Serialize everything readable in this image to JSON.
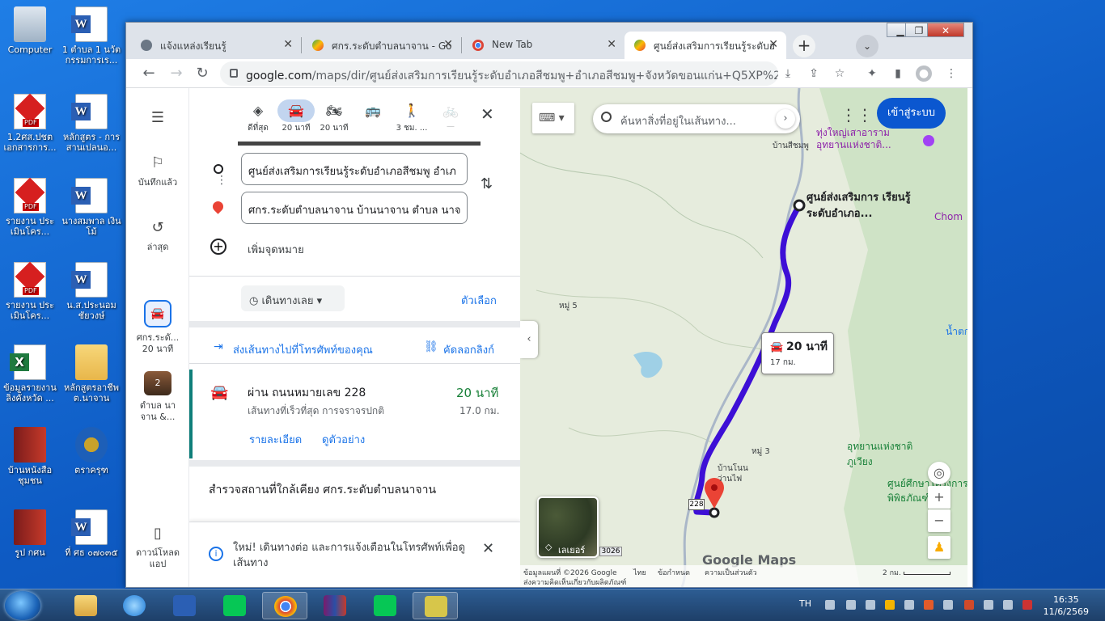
{
  "desktop": {
    "icons_col1": [
      "Computer",
      "1.2ศส.ปชต เอกสารการ...",
      "รายงาน ประเมินโคร...",
      "รายงาน ประเมินโคร...",
      "ข้อมูลรายงาน ลิ่งคั่งหวัด ...",
      "บ้านหนังสือ ชุมชน",
      "รูป กศน"
    ],
    "icons_col2": [
      "1 ตำบล 1 นวัต กรรมการเร...",
      "หลักสูตร - การ สานเปลนอ...",
      "นางสมพาล เงินโม้",
      "น.ส.ประนอม ชัยวงษ์",
      "หลักสูตรอาชีพ ต.นาจาน",
      "ตราครุฑ",
      "ที่ ศธ ๐๗๐๓๕"
    ]
  },
  "browser": {
    "tabs": [
      {
        "title": "แจ้งแหล่งเรียนรู้",
        "close": "✕"
      },
      {
        "title": "ศกร.ระดับตำบลนาจาน - Go",
        "close": "✕"
      },
      {
        "title": "New Tab",
        "close": "✕"
      },
      {
        "title": "ศูนย์ส่งเสริมการเรียนรู้ระดับอ",
        "close": "✕"
      }
    ],
    "new_tab": "+",
    "tab_menu": "⌄",
    "url_host": "google.com",
    "url_path": "/maps/dir/ศูนย์ส่งเสริมการเรียนรู้ระดับอำเภอสีชมพู+อำเภอสีชมพู+จังหวัดขอนแก่น+Q5XP%2B9PR..."
  },
  "rail": {
    "saved": "บันทึกแล้ว",
    "recent": "ล่าสุด",
    "route1_line1": "ศกร.ระดั...",
    "route1_line2": "20 นาที",
    "route2_line1": "ตำบล นา",
    "route2_line2": "จาน &...",
    "route2_badge": "2",
    "download_line1": "ดาวน์โหลด",
    "download_line2": "แอป"
  },
  "directions": {
    "modes": [
      {
        "label": "ดีที่สุด",
        "icon": "◈"
      },
      {
        "label": "20 นาที",
        "icon": "🚘"
      },
      {
        "label": "20 นาที",
        "icon": "🏍"
      },
      {
        "label": "",
        "icon": "🚌"
      },
      {
        "label": "3 ชม. ...",
        "icon": "🚶"
      },
      {
        "label": "—",
        "icon": "🚲"
      }
    ],
    "close": "✕",
    "origin": "ศูนย์ส่งเสริมการเรียนรู้ระดับอำเภอสีชมพู อำเภ",
    "destination": "ศกร.ระดับตำบลนาจาน บ้านนาจาน ตำบล นาจ",
    "add_destination": "เพิ่มจุดหมาย",
    "depart": "เดินทางเลย",
    "options": "ตัวเลือก",
    "send_to_phone": "ส่งเส้นทางไปที่โทรศัพท์ของคุณ",
    "copy_link": "คัดลอกลิงก์",
    "route": {
      "via": "ผ่าน ถนนหมายเลข 228",
      "time": "20 นาที",
      "desc": "เส้นทางที่เร็วที่สุด การจราจรปกติ",
      "distance": "17.0 กม.",
      "details": "รายละเอียด",
      "preview": "ดูตัวอย่าง"
    },
    "explore": "สำรวจสถานที่ใกล้เคียง ศกร.ระดับตำบลนาจาน",
    "notice": "ใหม่! เดินทางต่อ และการแจ้งเตือนในโทรศัพท์เพื่อดูเส้นทาง",
    "notice_close": "✕"
  },
  "map": {
    "search_placeholder": "ค้นหาสิ่งที่อยู่ในเส้นทาง...",
    "signin": "เข้าสู่ระบบ",
    "labels": {
      "temple": "ทุ่งใหญ่เสาอาราม อุทยานแห่งชาติ...",
      "ban_si_chomphu": "บ้านสีชมพู",
      "origin_name": "ศูนย์ส่งเสริมการ เรียนรู้ระดับอำเภอ...",
      "chom": "Chom",
      "moo5": "หมู่ 5",
      "namtok": "น้ำตกวั",
      "moo3": "หมู่ 3",
      "ban_non": "บ้านโนน ว่านไฟ",
      "park": "อุทยานแห่งชาติ ภูเวียง",
      "research": "ศูนย์ศึกษาโครงการ พิพิธภัณฑ์",
      "road228": "228",
      "road3026": "3026"
    },
    "bubble_time": "20 นาที",
    "bubble_dist": "17 กม.",
    "layers": "เลเยอร์",
    "google": "Google Maps",
    "attribution1": "ข้อมูลแผนที่ ©2026 Google",
    "attribution2": "ไทย",
    "attribution3": "ข้อกำหนด",
    "attribution4": "ความเป็นส่วนตัว",
    "attribution5": "ส่งความคิดเห็นเกี่ยวกับผลิตภัณฑ์",
    "scale": "2 กม."
  },
  "taskbar": {
    "lang": "TH",
    "time": "16:35",
    "date": "11/6/2569"
  }
}
